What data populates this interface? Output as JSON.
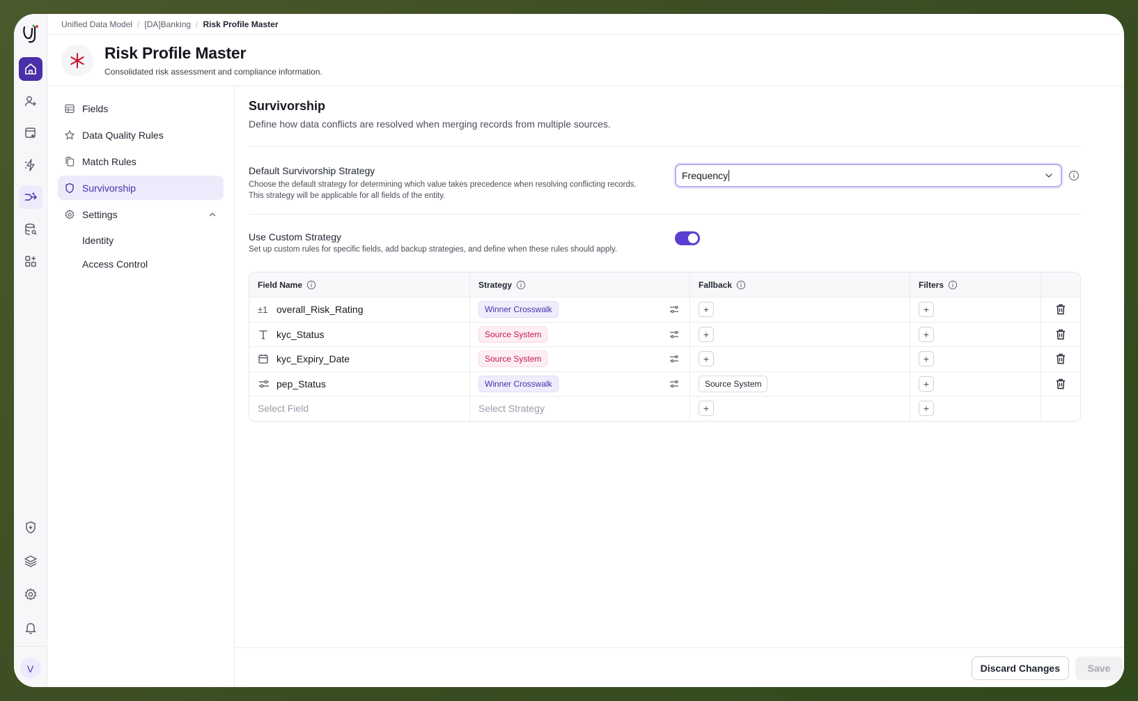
{
  "breadcrumb": {
    "items": [
      "Unified Data Model",
      "[DA]Banking",
      "Risk Profile Master"
    ]
  },
  "header": {
    "title": "Risk Profile Master",
    "subtitle": "Consolidated risk assessment and compliance information."
  },
  "rail": {
    "icons": [
      "home-icon",
      "user-plus-icon",
      "cards-sparkle-icon",
      "bolt-icon",
      "merge-arrows-icon",
      "database-search-icon",
      "grid-plus-icon"
    ],
    "bottom_icons": [
      "shield-sparkle-icon",
      "layers-icon",
      "gear-icon",
      "bell-icon"
    ],
    "avatar": "V"
  },
  "nav": {
    "items": [
      {
        "label": "Fields",
        "icon": "table-icon"
      },
      {
        "label": "Data Quality Rules",
        "icon": "star-icon"
      },
      {
        "label": "Match Rules",
        "icon": "copy-icon"
      },
      {
        "label": "Survivorship",
        "icon": "shield-icon"
      },
      {
        "label": "Settings",
        "icon": "gear-icon"
      }
    ],
    "settings_sub": [
      "Identity",
      "Access Control"
    ]
  },
  "section": {
    "title": "Survivorship",
    "description": "Define how data conflicts are resolved when merging records from multiple sources."
  },
  "default_strategy": {
    "label": "Default Survivorship Strategy",
    "description": "Choose the default strategy for determining which value takes precedence when resolving conflicting records. This strategy will be applicable for all fields of the entity.",
    "value": "Frequency"
  },
  "custom_strategy": {
    "label": "Use Custom Strategy",
    "description": "Set up custom rules for specific fields, add backup strategies, and define when these rules should apply.",
    "enabled": true
  },
  "table": {
    "headers": {
      "field": "Field Name",
      "strategy": "Strategy",
      "fallback": "Fallback",
      "filters": "Filters"
    },
    "rows": [
      {
        "icon_text": "±1",
        "field": "overall_Risk_Rating",
        "strategy": "Winner Crosswalk",
        "fallback": ""
      },
      {
        "icon_text": "T",
        "field": "kyc_Status",
        "strategy": "Source System",
        "fallback": ""
      },
      {
        "icon_text": "",
        "field": "kyc_Expiry_Date",
        "strategy": "Source System",
        "fallback": ""
      },
      {
        "icon_text": "",
        "field": "pep_Status",
        "strategy": "Winner Crosswalk",
        "fallback": "Source System"
      }
    ],
    "new_row": {
      "field_placeholder": "Select Field",
      "strategy_placeholder": "Select Strategy"
    }
  },
  "footer": {
    "discard": "Discard Changes",
    "save": "Save"
  },
  "colors": {
    "accent": "#4b2fa8",
    "toggle": "#5b3dd0",
    "winner_tag": "#4b2fa8",
    "source_tag": "#c2185b"
  }
}
